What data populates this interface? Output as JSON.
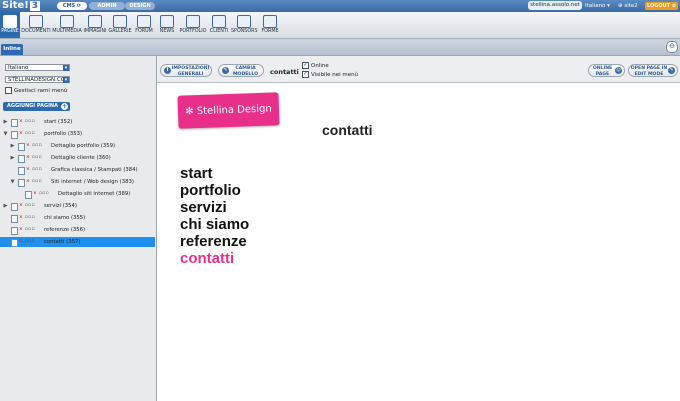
{
  "app": {
    "logo": "Site!",
    "logo_version": "3"
  },
  "modes": {
    "cms": "CMS",
    "admin": "ADMIN",
    "design": "DESIGN"
  },
  "topbar": {
    "domain": "stellina.assolo.net",
    "language": "Italiano",
    "site": "site2",
    "logout": "LOGOUT"
  },
  "toolbar": [
    {
      "label": "PAGINE",
      "icon": "globe-icon",
      "active": true
    },
    {
      "label": "DOCUMENTI",
      "icon": "document-icon"
    },
    {
      "label": "MULTIMEDIA",
      "icon": "film-icon"
    },
    {
      "label": "IMMAGINI",
      "icon": "image-icon"
    },
    {
      "label": "GALLERIE",
      "icon": "gallery-icon"
    },
    {
      "label": "FORUM",
      "icon": "chat-icon"
    },
    {
      "label": "NEWS",
      "icon": "news-icon"
    },
    {
      "label": "PORTFOLIO",
      "icon": "portfolio-icon"
    },
    {
      "label": "CLIENTI",
      "icon": "clients-icon"
    },
    {
      "label": "SPONSORS",
      "icon": "sponsors-icon"
    },
    {
      "label": "FORME",
      "icon": "forms-icon"
    }
  ],
  "subbar": {
    "tab": "Inline"
  },
  "sidebar": {
    "language_select": "Italiano",
    "site_select": "STELLINADESIGN.CC",
    "manage_branches": "Gestisci rami menù",
    "add_page": "AGGIUNGI PAGINA",
    "tree": [
      {
        "label": "start (352)",
        "level": 0,
        "toggle": "▶"
      },
      {
        "label": "portfolio (353)",
        "level": 0,
        "toggle": "▼"
      },
      {
        "label": "Dettaglio portfolio (359)",
        "level": 1,
        "toggle": "▶"
      },
      {
        "label": "Dettaglio cliente (360)",
        "level": 1,
        "toggle": "▶"
      },
      {
        "label": "Grafica classica / Stampati (384)",
        "level": 1,
        "toggle": ""
      },
      {
        "label": "Siti internet / Web design (383)",
        "level": 1,
        "toggle": "▼"
      },
      {
        "label": "Dettaglio siti internet (389)",
        "level": 2,
        "toggle": ""
      },
      {
        "label": "servizi (354)",
        "level": 0,
        "toggle": "▶"
      },
      {
        "label": "chi siamo (355)",
        "level": 0,
        "toggle": ""
      },
      {
        "label": "referenze (356)",
        "level": 0,
        "toggle": ""
      },
      {
        "label": "contatti (357)",
        "level": 0,
        "toggle": "",
        "selected": true
      }
    ]
  },
  "page_bar": {
    "settings_line1": "IMPOSTAZIONI",
    "settings_line2": "GENERALI",
    "template_line1": "CAMBIA",
    "template_line2": "MODELLO",
    "page_name": "contatti",
    "online": "Online",
    "visible": "Visibile nei menù",
    "online_line1": "ONLINE",
    "online_line2": "PAGE",
    "edit_line1": "OPEN PAGE IN",
    "edit_line2": "EDIT MODE"
  },
  "preview": {
    "brand": "Stellina Design",
    "heading": "contatti",
    "nav": [
      "start",
      "portfolio",
      "servizi",
      "chi siamo",
      "referenze",
      "contatti"
    ],
    "current_index": 5
  },
  "colors": {
    "accent": "#2e6ab0",
    "brand": "#e8308a",
    "selection": "#1f8ff0"
  }
}
